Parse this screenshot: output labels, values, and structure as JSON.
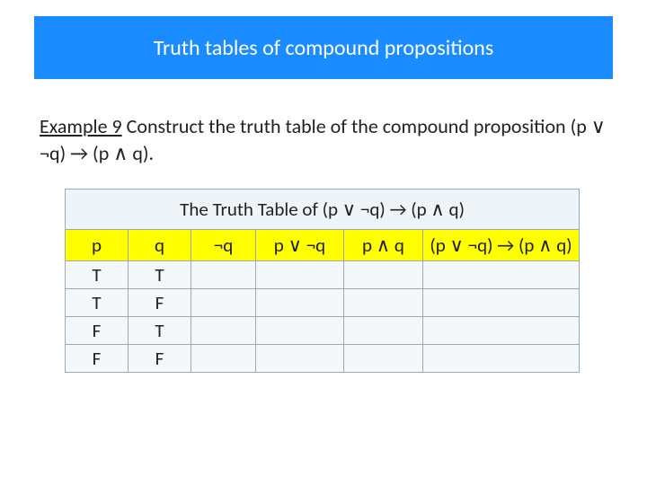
{
  "header": {
    "title": "Truth tables of compound propositions"
  },
  "example": {
    "label": "Example 9",
    "rest": " Construct the truth table of the compound proposition (p ∨ ¬q) → (p ∧ q)."
  },
  "table": {
    "caption": "The Truth Table of (p ∨ ¬q) → (p ∧ q)",
    "headers": {
      "p": "p",
      "q": "q",
      "nq": "¬q",
      "pnq": "p ∨ ¬q",
      "pq": "p ∧ q",
      "final": "(p ∨ ¬q) → (p ∧ q)"
    },
    "rows": [
      {
        "p": "T",
        "q": "T",
        "nq": "",
        "pnq": "",
        "pq": "",
        "final": ""
      },
      {
        "p": "T",
        "q": "F",
        "nq": "",
        "pnq": "",
        "pq": "",
        "final": ""
      },
      {
        "p": "F",
        "q": "T",
        "nq": "",
        "pnq": "",
        "pq": "",
        "final": ""
      },
      {
        "p": "F",
        "q": "F",
        "nq": "",
        "pnq": "",
        "pq": "",
        "final": ""
      }
    ]
  }
}
